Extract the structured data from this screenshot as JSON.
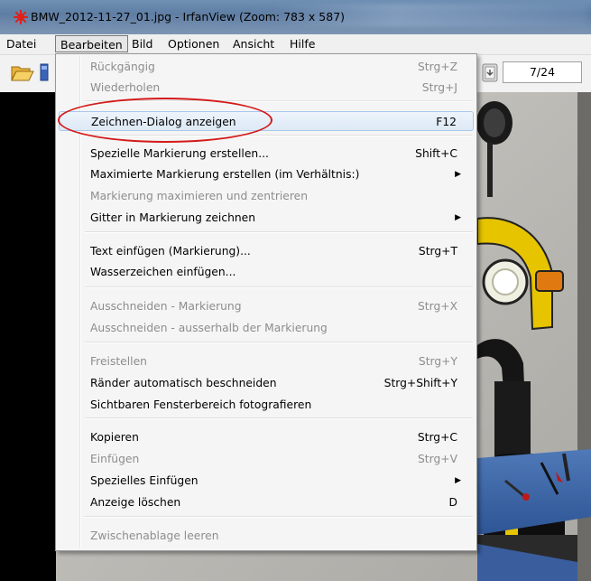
{
  "window": {
    "title": "BMW_2012-11-27_01.jpg - IrfanView (Zoom: 783 x 587)"
  },
  "menubar": {
    "items": [
      "Datei",
      "Bearbeiten",
      "Bild",
      "Optionen",
      "Ansicht",
      "Hilfe"
    ],
    "active": "Bearbeiten"
  },
  "toolbar": {
    "page_counter": "7/24"
  },
  "edit_menu": {
    "items": [
      {
        "label": "Rückgängig",
        "shortcut": "Strg+Z",
        "enabled": false
      },
      {
        "label": "Wiederholen",
        "shortcut": "Strg+J",
        "enabled": false
      },
      {
        "label": "Zeichnen-Dialog anzeigen",
        "shortcut": "F12",
        "enabled": true,
        "highlighted": true
      },
      {
        "label": "Spezielle Markierung erstellen...",
        "shortcut": "Shift+C",
        "enabled": true
      },
      {
        "label": "Maximierte Markierung erstellen (im Verhältnis:)",
        "shortcut": "",
        "enabled": true,
        "submenu": true
      },
      {
        "label": "Markierung maximieren und zentrieren",
        "shortcut": "",
        "enabled": false
      },
      {
        "label": "Gitter in Markierung zeichnen",
        "shortcut": "",
        "enabled": true,
        "submenu": true
      },
      {
        "label": "Text einfügen (Markierung)...",
        "shortcut": "Strg+T",
        "enabled": true
      },
      {
        "label": "Wasserzeichen einfügen...",
        "shortcut": "",
        "enabled": true
      },
      {
        "label": "Ausschneiden - Markierung",
        "shortcut": "Strg+X",
        "enabled": false
      },
      {
        "label": "Ausschneiden - ausserhalb der Markierung",
        "shortcut": "",
        "enabled": false
      },
      {
        "label": "Freistellen",
        "shortcut": "Strg+Y",
        "enabled": false
      },
      {
        "label": "Ränder automatisch beschneiden",
        "shortcut": "Strg+Shift+Y",
        "enabled": true
      },
      {
        "label": "Sichtbaren Fensterbereich fotografieren",
        "shortcut": "",
        "enabled": true
      },
      {
        "label": "Kopieren",
        "shortcut": "Strg+C",
        "enabled": true
      },
      {
        "label": "Einfügen",
        "shortcut": "Strg+V",
        "enabled": false
      },
      {
        "label": "Spezielles Einfügen",
        "shortcut": "",
        "enabled": true,
        "submenu": true
      },
      {
        "label": "Anzeige löschen",
        "shortcut": "D",
        "enabled": true
      },
      {
        "label": "Zwischenablage leeren",
        "shortcut": "",
        "enabled": false
      }
    ]
  },
  "annotation": {
    "color": "#d41a1a"
  },
  "colors": {
    "disabled_text": "#8d8d8d",
    "hover_border": "#a8c8ec"
  },
  "icons": [
    "irfanview-app-icon",
    "open-folder-icon",
    "slideshow-icon",
    "next-page-icon",
    "submenu-arrow-icon"
  ]
}
